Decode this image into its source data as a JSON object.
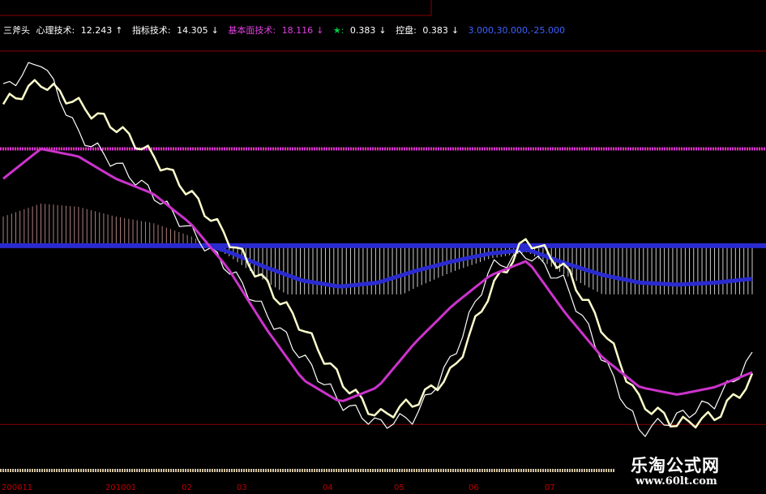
{
  "header": {
    "name": "三斧头",
    "items": [
      {
        "label": "心理技术:",
        "value": "12.243",
        "arrow": "↑",
        "color": "#ffffff"
      },
      {
        "label": "指标技术:",
        "value": "14.305",
        "arrow": "↓",
        "color": "#ffffff"
      },
      {
        "label": "基本面技术:",
        "value": "18.116",
        "arrow": "↓",
        "color": "#e040e0"
      },
      {
        "label": "★:",
        "value": "0.383",
        "arrow": "↓",
        "color": "#00cc44"
      },
      {
        "label": "控盘:",
        "value": "0.383",
        "arrow": "↓",
        "color": "#ffffff"
      }
    ],
    "tail": "3.000,30.000,-25.000"
  },
  "x_axis_labels": [
    "200011",
    "201001",
    "02",
    "03",
    "04",
    "05",
    "06",
    "07"
  ],
  "watermark": {
    "title": "乐淘公式网",
    "url": "www.60lt.com"
  },
  "chart_data": {
    "type": "line",
    "title": "",
    "xlabel": "",
    "ylabel": "",
    "x": [
      0,
      5,
      10,
      15,
      20,
      25,
      30,
      35,
      40,
      45,
      50,
      55,
      60,
      65,
      70,
      75,
      80,
      85,
      90,
      95,
      100
    ],
    "ylim": [
      -25,
      30
    ],
    "reference_lines": [
      30,
      16,
      3,
      -25
    ],
    "colors": {
      "pale_line": "#ffffcc",
      "white_line": "#ffffff",
      "magenta_line": "#cc33cc",
      "blue_area": "#2a2ad0",
      "pos_hist": "#d9a0a0",
      "neg_hist": "#ffffff",
      "grid": "#8b0000",
      "ref_magenta": "#cc33cc",
      "ref_blue": "#2a2ad0"
    },
    "series": [
      {
        "values": [
          22,
          25,
          22,
          19,
          15,
          10,
          4,
          -2,
          -8,
          -15,
          -20,
          -18,
          -14,
          -3,
          4,
          0,
          -8,
          -18,
          -21,
          -20,
          -15
        ]
      },
      {
        "values": [
          24,
          28,
          18,
          14,
          10,
          5,
          0,
          -6,
          -12,
          -18,
          -21,
          -20,
          -12,
          0,
          2,
          -2,
          -12,
          -22,
          -20,
          -18,
          -12
        ]
      },
      {
        "values": [
          12,
          16,
          15,
          12,
          10,
          6,
          0,
          -8,
          -15,
          -18,
          -16,
          -10,
          -5,
          -1,
          1,
          -6,
          -12,
          -16,
          -17,
          -16,
          -14
        ]
      }
    ]
  }
}
